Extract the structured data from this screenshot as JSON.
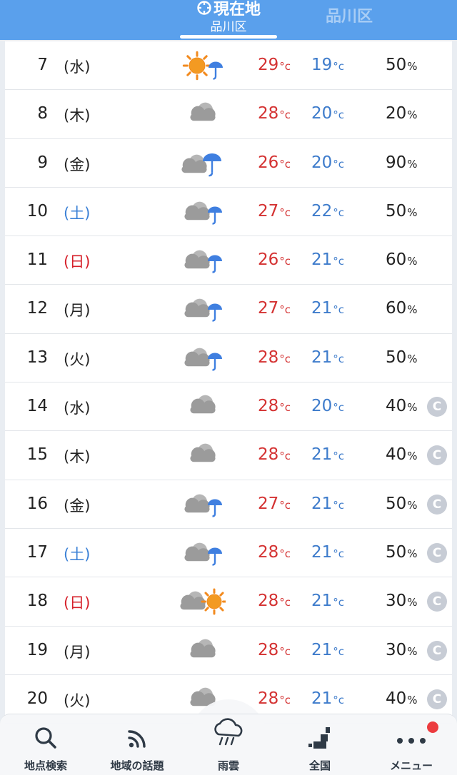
{
  "header": {
    "current_tab_title": "現在地",
    "current_tab_sub": "品川区",
    "other_tab": "品川区"
  },
  "units": {
    "temp": "°c",
    "pop": "%"
  },
  "rows": [
    {
      "day": "7",
      "dow": "(水)",
      "dow_type": "weekday",
      "icon": "sun-then-rain-icon",
      "hi": "29",
      "lo": "19",
      "pop": "50",
      "badge": ""
    },
    {
      "day": "8",
      "dow": "(木)",
      "dow_type": "weekday",
      "icon": "cloudy-icon",
      "hi": "28",
      "lo": "20",
      "pop": "20",
      "badge": ""
    },
    {
      "day": "9",
      "dow": "(金)",
      "dow_type": "weekday",
      "icon": "cloud-rain-icon",
      "hi": "26",
      "lo": "20",
      "pop": "90",
      "badge": ""
    },
    {
      "day": "10",
      "dow": "(土)",
      "dow_type": "sat",
      "icon": "cloud-then-rain-icon",
      "hi": "27",
      "lo": "22",
      "pop": "50",
      "badge": ""
    },
    {
      "day": "11",
      "dow": "(日)",
      "dow_type": "sun",
      "icon": "cloud-then-rain-icon",
      "hi": "26",
      "lo": "21",
      "pop": "60",
      "badge": ""
    },
    {
      "day": "12",
      "dow": "(月)",
      "dow_type": "weekday",
      "icon": "cloud-then-rain-icon",
      "hi": "27",
      "lo": "21",
      "pop": "60",
      "badge": ""
    },
    {
      "day": "13",
      "dow": "(火)",
      "dow_type": "weekday",
      "icon": "cloud-then-rain-icon",
      "hi": "28",
      "lo": "21",
      "pop": "50",
      "badge": ""
    },
    {
      "day": "14",
      "dow": "(水)",
      "dow_type": "weekday",
      "icon": "cloudy-icon",
      "hi": "28",
      "lo": "20",
      "pop": "40",
      "badge": "C"
    },
    {
      "day": "15",
      "dow": "(木)",
      "dow_type": "weekday",
      "icon": "cloudy-icon",
      "hi": "28",
      "lo": "21",
      "pop": "40",
      "badge": "C"
    },
    {
      "day": "16",
      "dow": "(金)",
      "dow_type": "weekday",
      "icon": "cloud-then-rain-icon",
      "hi": "27",
      "lo": "21",
      "pop": "50",
      "badge": "C"
    },
    {
      "day": "17",
      "dow": "(土)",
      "dow_type": "sat",
      "icon": "cloud-then-rain-icon",
      "hi": "28",
      "lo": "21",
      "pop": "50",
      "badge": "C"
    },
    {
      "day": "18",
      "dow": "(日)",
      "dow_type": "sun",
      "icon": "cloud-then-sun-icon",
      "hi": "28",
      "lo": "21",
      "pop": "30",
      "badge": "C"
    },
    {
      "day": "19",
      "dow": "(月)",
      "dow_type": "weekday",
      "icon": "cloudy-icon",
      "hi": "28",
      "lo": "21",
      "pop": "30",
      "badge": "C"
    },
    {
      "day": "20",
      "dow": "(火)",
      "dow_type": "weekday",
      "icon": "cloudy-icon",
      "hi": "28",
      "lo": "21",
      "pop": "40",
      "badge": "C"
    }
  ],
  "nav": [
    {
      "label": "地点検索",
      "icon": "search-icon"
    },
    {
      "label": "地域の話題",
      "icon": "rss-icon"
    },
    {
      "label": "雨雲",
      "icon": "rain-cloud-icon"
    },
    {
      "label": "全国",
      "icon": "nationwide-icon"
    },
    {
      "label": "メニュー",
      "icon": "menu-dots-icon",
      "notification": true
    }
  ],
  "colors": {
    "header": "#5aa0ec",
    "high": "#d43232",
    "low": "#3d7bcb",
    "sat": "#3a80d6",
    "sun": "#d6202a"
  }
}
